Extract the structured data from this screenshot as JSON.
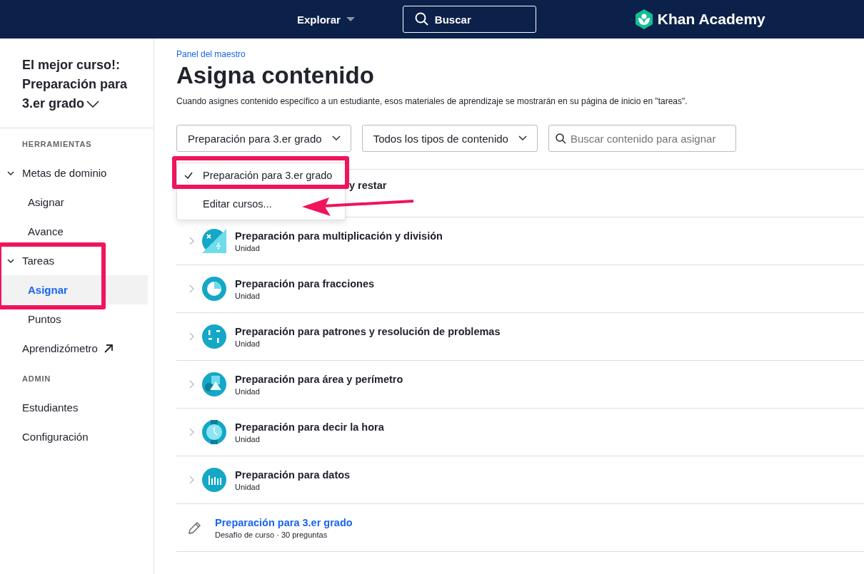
{
  "header": {
    "explore": "Explorar",
    "search": "Buscar",
    "logo": "Khan Academy"
  },
  "sidebar": {
    "course_title": "El mejor curso!: Preparación para 3.er grado",
    "sections": [
      {
        "heading": "HERRAMIENTAS",
        "items": [
          {
            "label": "Metas de dominio",
            "expanded": true,
            "selected": false,
            "children": [
              {
                "label": "Asignar",
                "selected": false
              },
              {
                "label": "Avance",
                "selected": false
              }
            ]
          },
          {
            "label": "Tareas",
            "expanded": true,
            "selected": false,
            "children": [
              {
                "label": "Asignar",
                "selected": true
              },
              {
                "label": "Puntos",
                "selected": false
              }
            ]
          },
          {
            "label": "Aprendizómetro",
            "external": true,
            "selected": false
          }
        ]
      },
      {
        "heading": "ADMIN",
        "items": [
          {
            "label": "Estudiantes",
            "selected": false
          },
          {
            "label": "Configuración",
            "selected": false
          }
        ]
      }
    ]
  },
  "breadcrumb": "Panel del maestro",
  "title": "Asigna contenido",
  "description": "Cuando asignes contenido específico a un estudiante, esos materiales de aprendizaje se mostrarán en su página de inicio en \"tareas\".",
  "filters": {
    "course": "Preparación para 3.er grado",
    "content_type": "Todos los tipos de contenido",
    "search_placeholder": "Buscar contenido para asignar"
  },
  "dropdown_menu": [
    {
      "label": "Preparación para 3.er grado",
      "selected": true
    },
    {
      "label": "Editar cursos...",
      "selected": false
    }
  ],
  "rows": [
    {
      "kind": "covered",
      "title": "y restar"
    },
    {
      "kind": "unit",
      "title": "Preparación para multiplicación y división",
      "subtitle": "Unidad"
    },
    {
      "kind": "unit",
      "title": "Preparación para fracciones",
      "subtitle": "Unidad"
    },
    {
      "kind": "unit",
      "title": "Preparación para patrones y resolución de problemas",
      "subtitle": "Unidad"
    },
    {
      "kind": "unit",
      "title": "Preparación para área y perímetro",
      "subtitle": "Unidad"
    },
    {
      "kind": "unit",
      "title": "Preparación para decir la hora",
      "subtitle": "Unidad"
    },
    {
      "kind": "unit",
      "title": "Preparación para datos",
      "subtitle": "Unidad"
    },
    {
      "kind": "challenge",
      "title": "Preparación para 3.er grado",
      "subtitle": "Desafío de curso · 30 preguntas"
    }
  ]
}
